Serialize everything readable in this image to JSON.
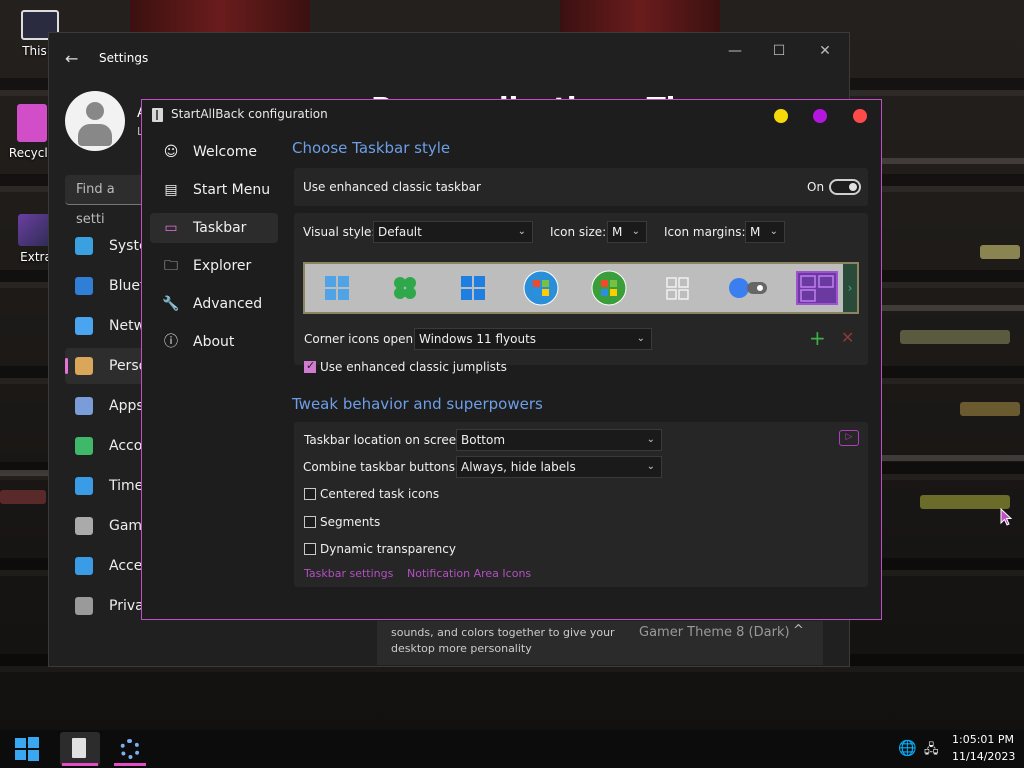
{
  "desktop": {
    "icons": [
      {
        "label": "This P",
        "icon": "monitor-icon"
      },
      {
        "label": "Recycle",
        "icon": "recycle-bin-icon"
      },
      {
        "label": "Extra",
        "icon": "game-folder-icon"
      }
    ]
  },
  "settings_window": {
    "title": "Settings",
    "back_glyph": "←",
    "controls": {
      "minimize": "—",
      "maximize": "☐",
      "close": "✕"
    },
    "account_name_fragment": "A",
    "account_sub_fragment": "L",
    "search_placeholder": "Find a setti",
    "nav": [
      {
        "label": "Syste",
        "icon": "monitor-icon",
        "color": "#3aa0e0"
      },
      {
        "label": "Blueto",
        "icon": "bluetooth-icon",
        "color": "#2f7fd6"
      },
      {
        "label": "Netw",
        "icon": "wifi-icon",
        "color": "#4aa4f0"
      },
      {
        "label": "Perso",
        "icon": "brush-icon",
        "color": "#d9a65a",
        "selected": true
      },
      {
        "label": "Apps",
        "icon": "apps-icon",
        "color": "#7a9cd8"
      },
      {
        "label": "Accou",
        "icon": "account-icon",
        "color": "#3fb86a"
      },
      {
        "label": "Time",
        "icon": "clock-globe-icon",
        "color": "#3a9be6"
      },
      {
        "label": "Gami",
        "icon": "gamepad-icon",
        "color": "#aaaaaa"
      },
      {
        "label": "Acces",
        "icon": "accessibility-icon",
        "color": "#3a9be6"
      },
      {
        "label": "Priva",
        "icon": "shield-icon",
        "color": "#9a9a9a"
      }
    ],
    "page_title_fragment": "Personalization › Themes",
    "theme_card": {
      "description": "sounds, and colors together to give your desktop more personality",
      "current_theme": "Gamer Theme 8 (Dark)",
      "chevron": "^"
    }
  },
  "sab_window": {
    "title": "StartAllBack configuration",
    "controls": {
      "yellow": "#f5d90a",
      "purple": "#b416e0",
      "red": "#ff4a4a"
    },
    "sidebar": [
      {
        "label": "Welcome",
        "icon": "smile-icon",
        "glyph": "☺"
      },
      {
        "label": "Start Menu",
        "icon": "start-menu-icon",
        "glyph": "▤"
      },
      {
        "label": "Taskbar",
        "icon": "taskbar-icon",
        "glyph": "▭",
        "selected": true
      },
      {
        "label": "Explorer",
        "icon": "folder-icon",
        "glyph": "🗀"
      },
      {
        "label": "Advanced",
        "icon": "wrench-icon",
        "glyph": "🔧"
      },
      {
        "label": "About",
        "icon": "info-icon",
        "glyph": "ⓘ"
      }
    ],
    "section1_title": "Choose Taskbar style",
    "enhanced_taskbar": {
      "label": "Use enhanced classic taskbar",
      "state": "On",
      "on": true
    },
    "visual_style": {
      "label": "Visual style:",
      "value": "Default"
    },
    "icon_size": {
      "label": "Icon size:",
      "value": "M"
    },
    "icon_margins": {
      "label": "Icon margins:",
      "value": "M"
    },
    "style_previews": [
      {
        "name": "win11-style-icon",
        "color": "#4fa3e6"
      },
      {
        "name": "clover-style-icon",
        "color": "#2ea84a"
      },
      {
        "name": "win10-style-icon",
        "color": "#1e7fe0"
      },
      {
        "name": "win7-orb-icon",
        "color": "#2a8fd8"
      },
      {
        "name": "vista-orb-icon",
        "color": "#3a9f3a"
      },
      {
        "name": "grid-style-icon",
        "color": "#f2f2f2"
      },
      {
        "name": "pill-toggle-style-icon",
        "color": "#3a7ff0"
      },
      {
        "name": "custom-style-icon",
        "color": "#a050d0"
      }
    ],
    "corner_icons": {
      "label": "Corner icons open:",
      "value": "Windows 11 flyouts"
    },
    "add_glyph": "+",
    "remove_glyph": "✕",
    "jumplists": {
      "label": "Use enhanced classic jumplists",
      "checked": true
    },
    "section2_title": "Tweak behavior and superpowers",
    "taskbar_location": {
      "label": "Taskbar location on screen:",
      "value": "Bottom"
    },
    "combine_buttons": {
      "label": "Combine taskbar buttons:",
      "value": "Always, hide labels"
    },
    "centered": {
      "label": "Centered task icons",
      "checked": false
    },
    "segments": {
      "label": "Segments",
      "checked": false
    },
    "dynamic_transparency": {
      "label": "Dynamic transparency",
      "checked": false
    },
    "links": {
      "taskbar_settings": "Taskbar settings",
      "notification_icons": "Notification Area Icons"
    }
  },
  "taskbar": {
    "time": "1:05:01 PM",
    "date": "11/14/2023",
    "accent": "#e34ec7"
  }
}
